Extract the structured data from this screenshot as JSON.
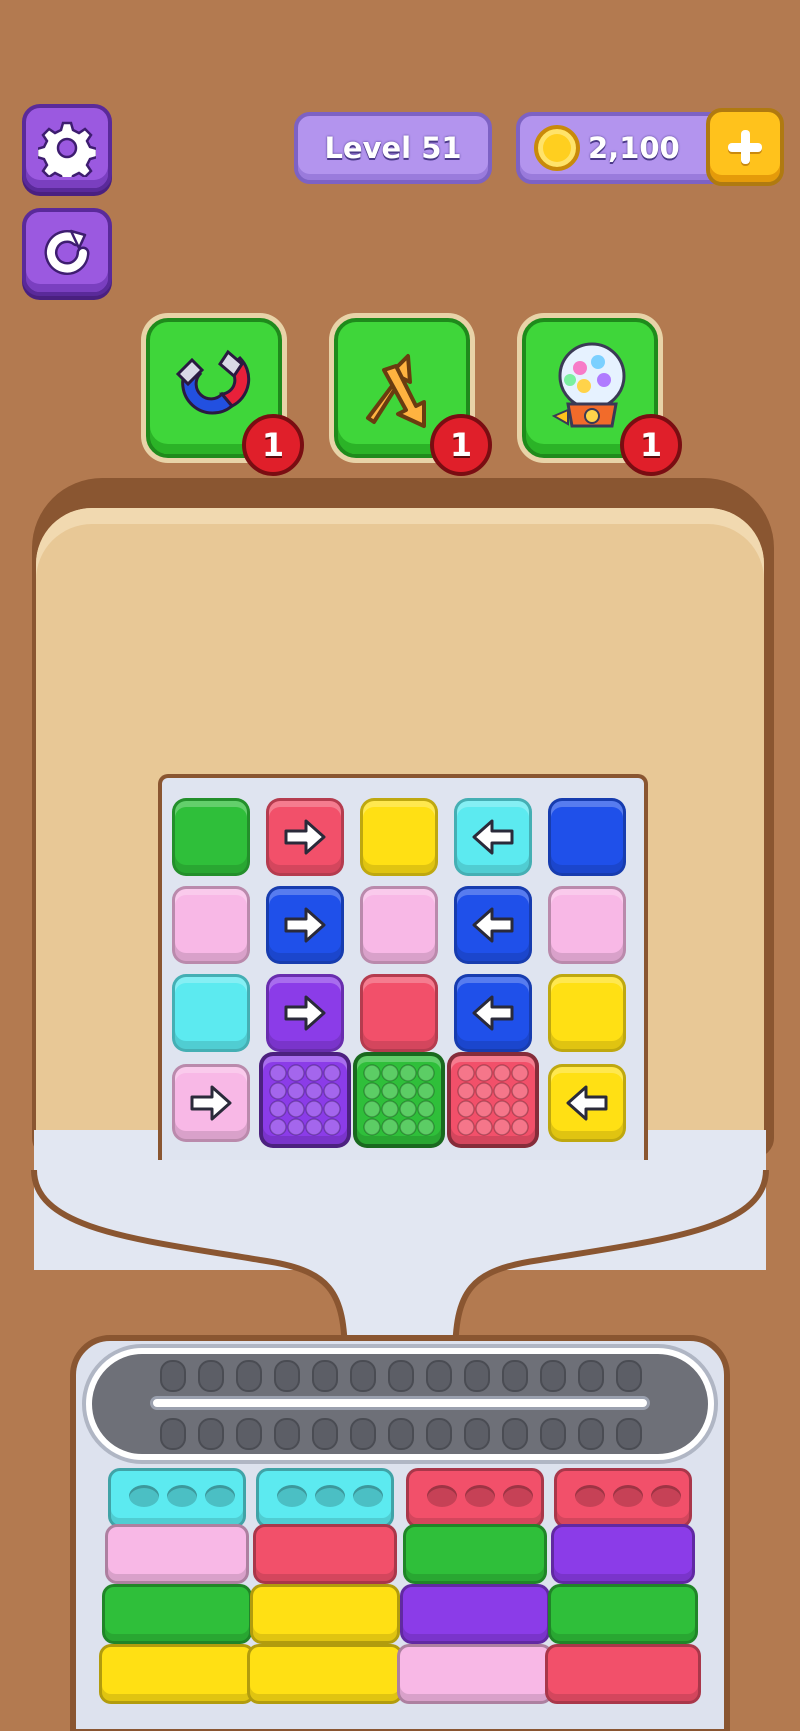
{
  "hud": {
    "level_label": "Level 51",
    "coins": "2,100"
  },
  "boosters": [
    {
      "name": "magnet",
      "count": "1"
    },
    {
      "name": "shuffle",
      "count": "1"
    },
    {
      "name": "gumball-machine",
      "count": "1"
    }
  ],
  "colors": {
    "green": "#2fbf3a",
    "red": "#f2506a",
    "yellow": "#ffe014",
    "cyan": "#5ceaf0",
    "blue": "#1f50ea",
    "pink": "#f8b8e6",
    "purple": "#8b3ce8"
  },
  "grid": [
    [
      {
        "c": "green"
      },
      {
        "c": "red",
        "arrow": "right"
      },
      {
        "c": "yellow"
      },
      {
        "c": "cyan",
        "arrow": "left"
      },
      {
        "c": "blue"
      }
    ],
    [
      {
        "c": "pink"
      },
      {
        "c": "blue",
        "arrow": "right"
      },
      {
        "c": "pink"
      },
      {
        "c": "blue",
        "arrow": "left"
      },
      {
        "c": "pink"
      }
    ],
    [
      {
        "c": "cyan"
      },
      {
        "c": "purple",
        "arrow": "right"
      },
      {
        "c": "red"
      },
      {
        "c": "blue",
        "arrow": "left"
      },
      {
        "c": "yellow"
      }
    ],
    [
      {
        "c": "pink",
        "arrow": "right"
      },
      {
        "c": "purple",
        "studs": true
      },
      {
        "c": "green",
        "studs": true
      },
      {
        "c": "red",
        "studs": true
      },
      {
        "c": "yellow",
        "arrow": "left"
      }
    ]
  ],
  "stacks": [
    [
      "cyan",
      "pink",
      "green",
      "yellow"
    ],
    [
      "cyan",
      "red",
      "yellow",
      "yellow"
    ],
    [
      "red",
      "green",
      "purple",
      "pink"
    ],
    [
      "red",
      "purple",
      "green",
      "red"
    ]
  ]
}
